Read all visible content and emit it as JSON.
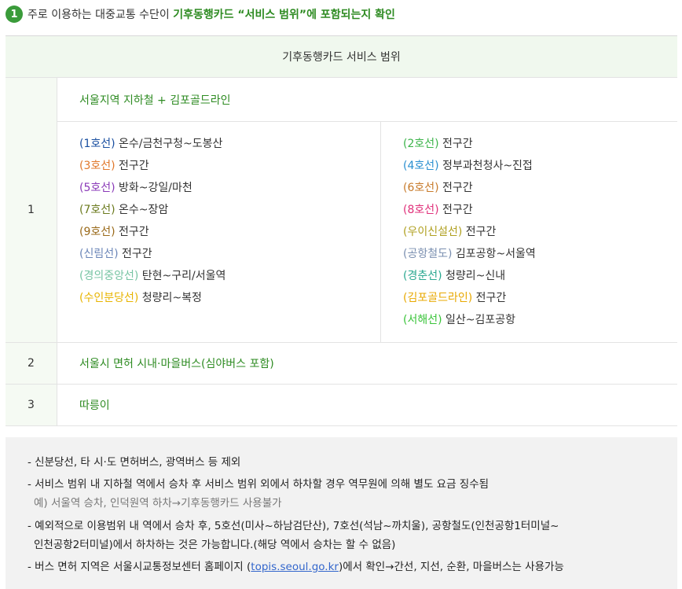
{
  "header": {
    "step_number": "1",
    "text_before": "주로 이용하는 대중교통 수단이 ",
    "highlight": "기후동행카드 “서비스 범위”에 포함되는지 확인"
  },
  "table": {
    "title": "기후동행카드 서비스 범위",
    "rows": [
      {
        "num": "1",
        "title": "서울지역 지하철 + 김포골드라인",
        "left_lines": [
          {
            "name": "(1호선)",
            "color": "#1a4fa0",
            "range": " 온수/금천구청~도봉산"
          },
          {
            "name": "(3호선)",
            "color": "#e0772a",
            "range": " 전구간"
          },
          {
            "name": "(5호선)",
            "color": "#8a3ab8",
            "range": " 방화~강일/마천"
          },
          {
            "name": "(7호선)",
            "color": "#6b7a1e",
            "range": " 온수~장암"
          },
          {
            "name": "(9호선)",
            "color": "#9a6a1a",
            "range": " 전구간"
          },
          {
            "name": "(신림선)",
            "color": "#6b86b8",
            "range": " 전구간"
          },
          {
            "name": "(경의중앙선)",
            "color": "#77c4a3",
            "range": " 탄현~구리/서울역"
          },
          {
            "name": "(수인분당선)",
            "color": "#e8b400",
            "range": " 청량리~복정"
          }
        ],
        "right_lines": [
          {
            "name": "(2호선)",
            "color": "#3cb44a",
            "range": " 전구간"
          },
          {
            "name": "(4호선)",
            "color": "#2a8fd0",
            "range": " 정부과천청사~진접"
          },
          {
            "name": "(6호선)",
            "color": "#c77a2a",
            "range": " 전구간"
          },
          {
            "name": "(8호선)",
            "color": "#e0307a",
            "range": " 전구간"
          },
          {
            "name": "(우이신설선)",
            "color": "#b0a020",
            "range": " 전구간"
          },
          {
            "name": "(공항철도)",
            "color": "#7a8fb0",
            "range": " 김포공항~서울역"
          },
          {
            "name": "(경춘선)",
            "color": "#2aa890",
            "range": " 청량리~신내"
          },
          {
            "name": "(김포골드라인)",
            "color": "#e8a800",
            "range": " 전구간"
          },
          {
            "name": "(서해선)",
            "color": "#3ac43a",
            "range": " 일산~김포공항"
          }
        ]
      },
      {
        "num": "2",
        "title": "서울시 면허 시내·마을버스(심야버스 포함)"
      },
      {
        "num": "3",
        "title": "따릉이"
      }
    ]
  },
  "notes": {
    "n1": "- 신분당선, 타 시·도 면허버스, 광역버스 등 제외",
    "n2": "- 서비스 범위 내 지하철 역에서 승차 후 서비스 범위 외에서 하차할 경우 역무원에 의해 별도 요금 징수됨",
    "n2_example": "예) 서울역 승차, 인덕원역 하차→기후동행카드 사용불가",
    "n3": "- 예외적으로 이용범위 내 역에서 승차 후,  5호선(미사~하남검단산), 7호선(석남~까치울), 공항철도(인천공항1터미널~",
    "n3_cont": "인천공항2터미널)에서 하차하는 것은 가능합니다.(해당 역에서 승차는 할 수 없음)",
    "n4_before": "- 버스 면허 지역은 서울시교통정보센터 홈페이지 (",
    "n4_link": "topis.seoul.go.kr",
    "n4_after": ")에서 확인→간선, 지선, 순환, 마을버스는 사용가능"
  }
}
